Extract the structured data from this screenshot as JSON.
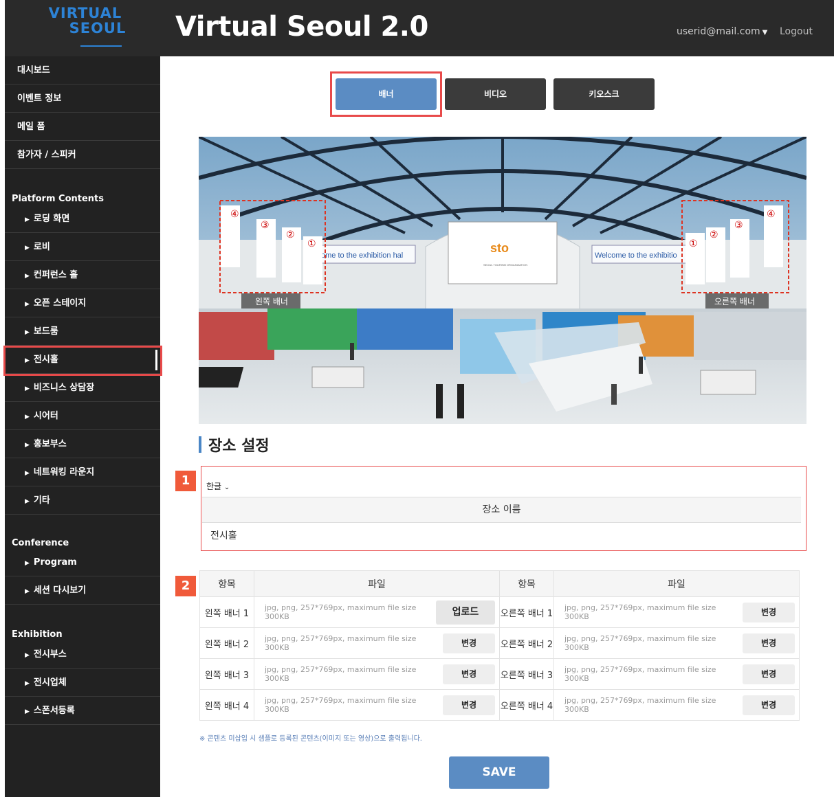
{
  "header": {
    "logo_line1": "VIRTUAL",
    "logo_line2": "SEOUL",
    "app_title": "Virtual Seoul 2.0",
    "user_email": "userid@mail.com",
    "logout_label": "Logout"
  },
  "sidebar": {
    "top_items": [
      "대시보드",
      "이벤트 정보",
      "메일 폼",
      "참가자 / 스피커"
    ],
    "platform_section": "Platform Contents",
    "platform_items": [
      "로딩 화면",
      "로비",
      "컨퍼런스 홀",
      "오픈 스테이지",
      "보드룸",
      "전시홀",
      "비즈니스 상담장",
      "시어터",
      "홍보부스",
      "네트워킹 라운지",
      "기타"
    ],
    "active_item": "전시홀",
    "conference_section": "Conference",
    "conference_items": [
      "Program",
      "세션 다시보기"
    ],
    "exhibition_section": "Exhibition",
    "exhibition_items": [
      "전시부스",
      "전시업체",
      "스폰서등록"
    ]
  },
  "tabs": [
    {
      "label": "배너",
      "active": true
    },
    {
      "label": "비디오",
      "active": false
    },
    {
      "label": "키오스크",
      "active": false
    }
  ],
  "scene": {
    "left_banner_label": "왼쪽 배너",
    "right_banner_label": "오른쪽 배너",
    "left_screen_text": "ome to the exhibition hal",
    "right_screen_text": "Welcome to the exhibitio",
    "center_logo": "sto",
    "center_logo_sub": "SEOUL TOURISM ORGANIZATION",
    "left_numbers": [
      "④",
      "③",
      "②",
      "①"
    ],
    "right_numbers": [
      "①",
      "②",
      "③",
      "④"
    ]
  },
  "location": {
    "section_title": "장소 설정",
    "badge1": "1",
    "language": "한글",
    "column_header": "장소 이름",
    "value": "전시홀"
  },
  "banners": {
    "badge2": "2",
    "headers": [
      "항목",
      "파일",
      "항목",
      "파일"
    ],
    "hint": "jpg, png, 257*769px, maximum file size 300KB",
    "rows": [
      {
        "left_label": "왼쪽 배너 1",
        "left_button": "업로드",
        "right_label": "오른쪽 배너 1",
        "right_button": "변경"
      },
      {
        "left_label": "왼쪽 배너 2",
        "left_button": "변경",
        "right_label": "오른쪽 배너 2",
        "right_button": "변경"
      },
      {
        "left_label": "왼쪽 배너 3",
        "left_button": "변경",
        "right_label": "오른쪽 배너 3",
        "right_button": "변경"
      },
      {
        "left_label": "왼쪽 배너 4",
        "left_button": "변경",
        "right_label": "오른쪽 배너 4",
        "right_button": "변경"
      }
    ]
  },
  "note": "※ 콘텐츠 미삽입 시 샘플로 등록된 콘텐츠(이미지 또는 영상)으로 출력됩니다.",
  "save_label": "SAVE",
  "colors": {
    "accent": "#5b8cc3",
    "highlight": "#e84a4a",
    "badge": "#f05a3a",
    "sidebar_bg": "#222222"
  }
}
